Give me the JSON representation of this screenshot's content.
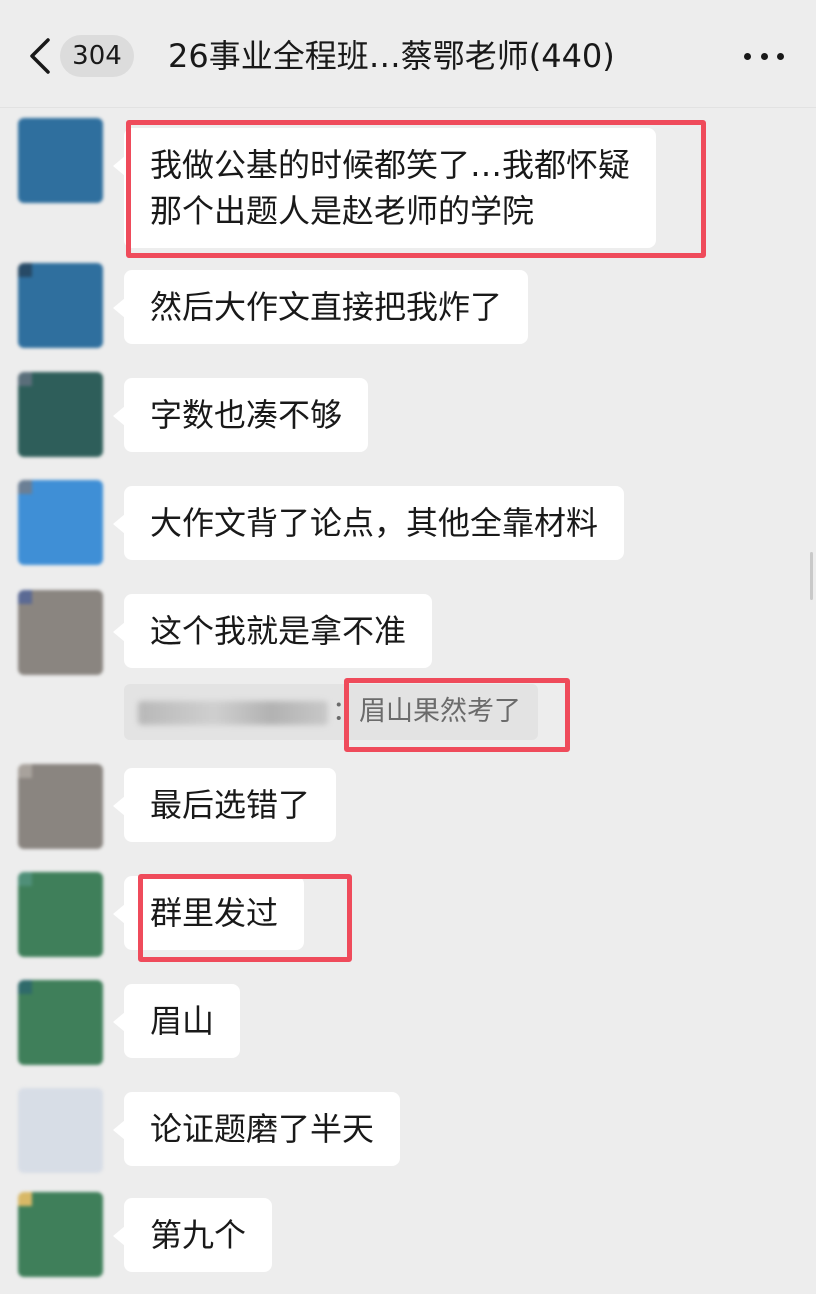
{
  "header": {
    "badge_count": "304",
    "title": "26事业全程班…蔡鄂老师(440)"
  },
  "messages": [
    {
      "lines": [
        "我做公基的时候都笑了…我都怀疑",
        "那个出题人是赵老师的学院"
      ]
    },
    {
      "lines": [
        "然后大作文直接把我炸了"
      ]
    },
    {
      "lines": [
        "字数也凑不够"
      ]
    },
    {
      "lines": [
        "大作文背了论点，其他全靠材料"
      ]
    },
    {
      "lines": [
        "这个我就是拿不准"
      ]
    },
    {
      "lines": [
        "最后选错了"
      ]
    },
    {
      "lines": [
        "群里发过"
      ]
    },
    {
      "lines": [
        "眉山"
      ]
    },
    {
      "lines": [
        "论证题磨了半天"
      ]
    },
    {
      "lines": [
        "第九个"
      ]
    }
  ],
  "quote": {
    "separator": "：",
    "text": "眉山果然考了"
  },
  "colors": {
    "background": "#ededed",
    "bubble": "#ffffff",
    "highlight": "#ef4b5b",
    "quote_background": "#e3e3e3"
  },
  "icons": {
    "back": "chevron-left-icon",
    "more": "more-dots-icon"
  }
}
